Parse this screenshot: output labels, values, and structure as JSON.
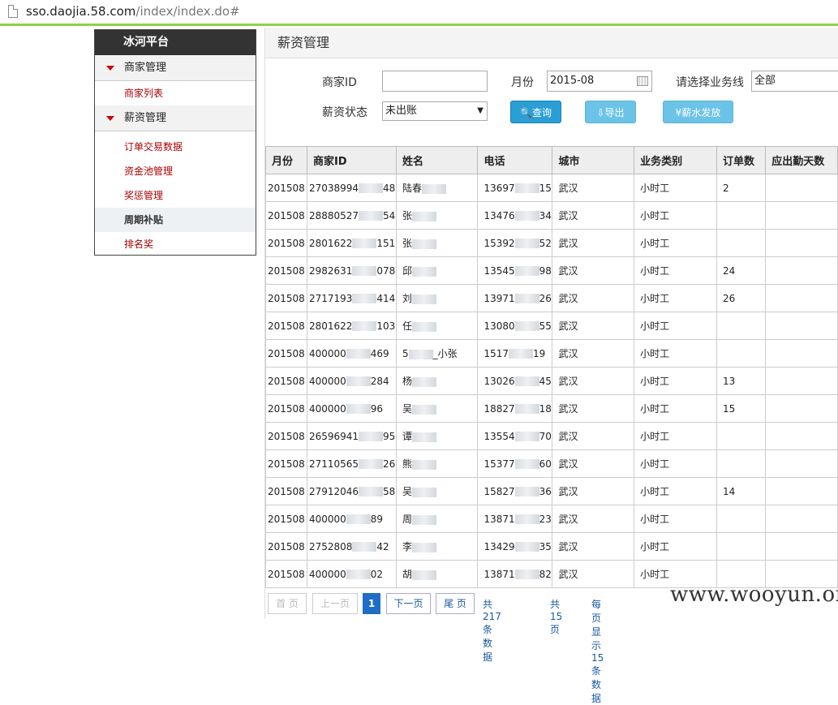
{
  "browser": {
    "url_host": "sso.daojia.58.com",
    "url_path": "/index/index.do#"
  },
  "sidebar": {
    "brand": "冰河平台",
    "groups": [
      {
        "label": "商家管理",
        "items": [
          "商家列表"
        ]
      },
      {
        "label": "薪资管理",
        "items": [
          "订单交易数据",
          "资金池管理",
          "奖惩管理",
          "周期补贴",
          "排名奖"
        ]
      }
    ]
  },
  "main": {
    "title": "薪资管理",
    "form": {
      "merchant_id_label": "商家ID",
      "merchant_id_value": "",
      "month_label": "月份",
      "month_value": "2015-08",
      "business_label": "请选择业务线",
      "business_value": "全部",
      "status_label": "薪资状态",
      "status_value": "未出账",
      "query_button": "查询",
      "export_button": "导出",
      "pay_button": "薪水发放"
    },
    "table": {
      "headers": [
        "月份",
        "商家ID",
        "姓名",
        "电话",
        "城市",
        "业务类别",
        "订单数",
        "应出勤天数"
      ],
      "rows": [
        {
          "month": "201508",
          "id_a": "27038994",
          "id_b": "48",
          "name_a": "陆春",
          "name_b": "",
          "phone_a": "13697",
          "phone_b": "15",
          "city": "武汉",
          "type": "小时工",
          "orders": "2"
        },
        {
          "month": "201508",
          "id_a": "28880527",
          "id_b": "54",
          "name_a": "张",
          "name_b": "",
          "phone_a": "13476",
          "phone_b": "34",
          "city": "武汉",
          "type": "小时工",
          "orders": ""
        },
        {
          "month": "201508",
          "id_a": "2801622",
          "id_b": "151",
          "name_a": "张",
          "name_b": "",
          "phone_a": "15392",
          "phone_b": "52",
          "city": "武汉",
          "type": "小时工",
          "orders": ""
        },
        {
          "month": "201508",
          "id_a": "2982631",
          "id_b": "078",
          "name_a": "邱",
          "name_b": "",
          "phone_a": "13545",
          "phone_b": "98",
          "city": "武汉",
          "type": "小时工",
          "orders": "24"
        },
        {
          "month": "201508",
          "id_a": "2717193",
          "id_b": "414",
          "name_a": "刘",
          "name_b": "",
          "phone_a": "13971",
          "phone_b": "26",
          "city": "武汉",
          "type": "小时工",
          "orders": "26"
        },
        {
          "month": "201508",
          "id_a": "2801622",
          "id_b": "103",
          "name_a": "任",
          "name_b": "",
          "phone_a": "13080",
          "phone_b": "55",
          "city": "武汉",
          "type": "小时工",
          "orders": ""
        },
        {
          "month": "201508",
          "id_a": "400000",
          "id_b": "469",
          "name_a": "5",
          "name_b": "_小张",
          "phone_a": "1517",
          "phone_b": "19",
          "city": "武汉",
          "type": "小时工",
          "orders": ""
        },
        {
          "month": "201508",
          "id_a": "400000",
          "id_b": "284",
          "name_a": "杨",
          "name_b": "",
          "phone_a": "13026",
          "phone_b": "45",
          "city": "武汉",
          "type": "小时工",
          "orders": "13"
        },
        {
          "month": "201508",
          "id_a": "400000",
          "id_b": "96",
          "name_a": "吴",
          "name_b": "",
          "phone_a": "18827",
          "phone_b": "18",
          "city": "武汉",
          "type": "小时工",
          "orders": "15"
        },
        {
          "month": "201508",
          "id_a": "26596941",
          "id_b": "95",
          "name_a": "谭",
          "name_b": "",
          "phone_a": "13554",
          "phone_b": "70",
          "city": "武汉",
          "type": "小时工",
          "orders": ""
        },
        {
          "month": "201508",
          "id_a": "27110565",
          "id_b": "26",
          "name_a": "熊",
          "name_b": "",
          "phone_a": "15377",
          "phone_b": "60",
          "city": "武汉",
          "type": "小时工",
          "orders": ""
        },
        {
          "month": "201508",
          "id_a": "27912046",
          "id_b": "58",
          "name_a": "吴",
          "name_b": "",
          "phone_a": "15827",
          "phone_b": "36",
          "city": "武汉",
          "type": "小时工",
          "orders": "14"
        },
        {
          "month": "201508",
          "id_a": "400000",
          "id_b": "89",
          "name_a": "周",
          "name_b": "",
          "phone_a": "13871",
          "phone_b": "23",
          "city": "武汉",
          "type": "小时工",
          "orders": ""
        },
        {
          "month": "201508",
          "id_a": "2752808",
          "id_b": "42",
          "name_a": "李",
          "name_b": "",
          "phone_a": "13429",
          "phone_b": "35",
          "city": "武汉",
          "type": "小时工",
          "orders": ""
        },
        {
          "month": "201508",
          "id_a": "400000",
          "id_b": "02",
          "name_a": "胡",
          "name_b": "",
          "phone_a": "13871",
          "phone_b": "82",
          "city": "武汉",
          "type": "小时工",
          "orders": ""
        }
      ]
    },
    "pager": {
      "first": "首 页",
      "prev": "上一页",
      "current": "1",
      "next": "下一页",
      "last": "尾 页",
      "total_records": "共217条数据",
      "total_pages": "共15页",
      "per_page": "每页显示15条数据"
    }
  },
  "watermark": "www.wooyun.org"
}
